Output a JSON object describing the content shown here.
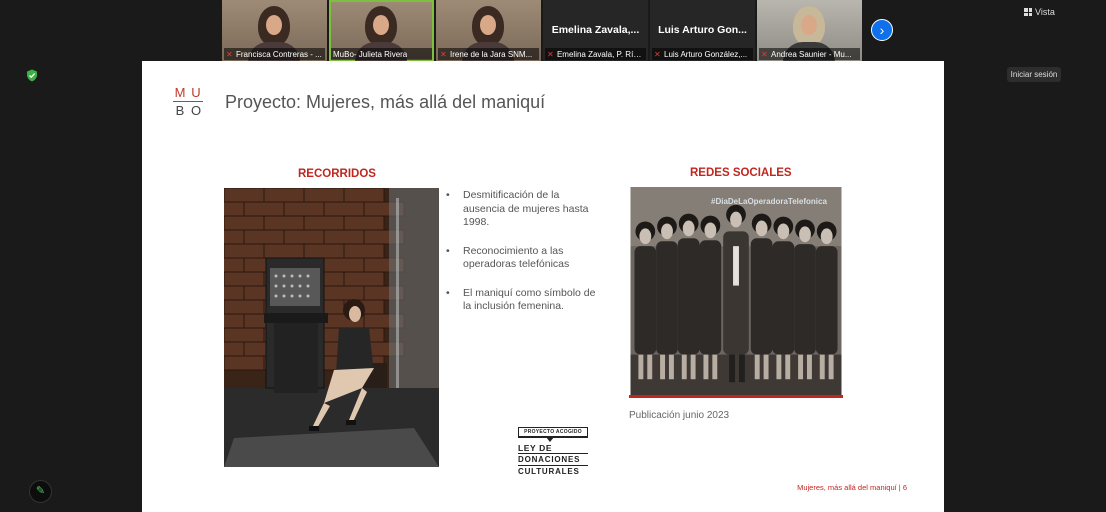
{
  "participants": [
    {
      "name": "Francisca Contreras - ...",
      "type": "video",
      "speaker": false
    },
    {
      "name": "MuBo- Julieta Rivera",
      "type": "video",
      "speaker": true
    },
    {
      "name": "Irene de la Jara SNM...",
      "type": "video",
      "speaker": false
    },
    {
      "name": "Emelina Zavala, P. Río...",
      "type": "name",
      "display": "Emelina  Zavala,...",
      "speaker": false
    },
    {
      "name": "Luis Arturo González,...",
      "type": "name",
      "display": "Luis Arturo Gon...",
      "speaker": false
    },
    {
      "name": "Andrea Saunier - Mu...",
      "type": "video",
      "speaker": false
    }
  ],
  "toolbar": {
    "view_label": "Vista",
    "signin_label": "Iniciar sesión",
    "next_icon": "chevron-right-icon",
    "annotate_icon": "pencil-icon",
    "security_icon": "shield-icon"
  },
  "slide": {
    "logo_letters": [
      "M",
      "U",
      "B",
      "O"
    ],
    "title": "Proyecto: Mujeres, más allá del maniquí",
    "left_section_title": "RECORRIDOS",
    "right_section_title": "REDES SOCIALES",
    "bullets": [
      "Desmitificación de la ausencia de mujeres hasta 1998.",
      "Reconocimiento a las operadoras telefónicas",
      "El maniquí como símbolo de la inclusión femenina."
    ],
    "hashtag": "#DiaDeLaOperadoraTelefonica",
    "publication_caption": "Publicación junio 2023",
    "ley_logo": {
      "top": "PROYECTO ACOGIDO",
      "line1": "LEY DE",
      "line2": "DONACIONES",
      "line3": "CULTURALES"
    },
    "footer": "Mujeres, más allá del maniquí | 6"
  },
  "colors": {
    "accent_red": "#c0271f",
    "zoom_blue": "#0e71eb",
    "speaker_green": "#7fbf3f"
  }
}
